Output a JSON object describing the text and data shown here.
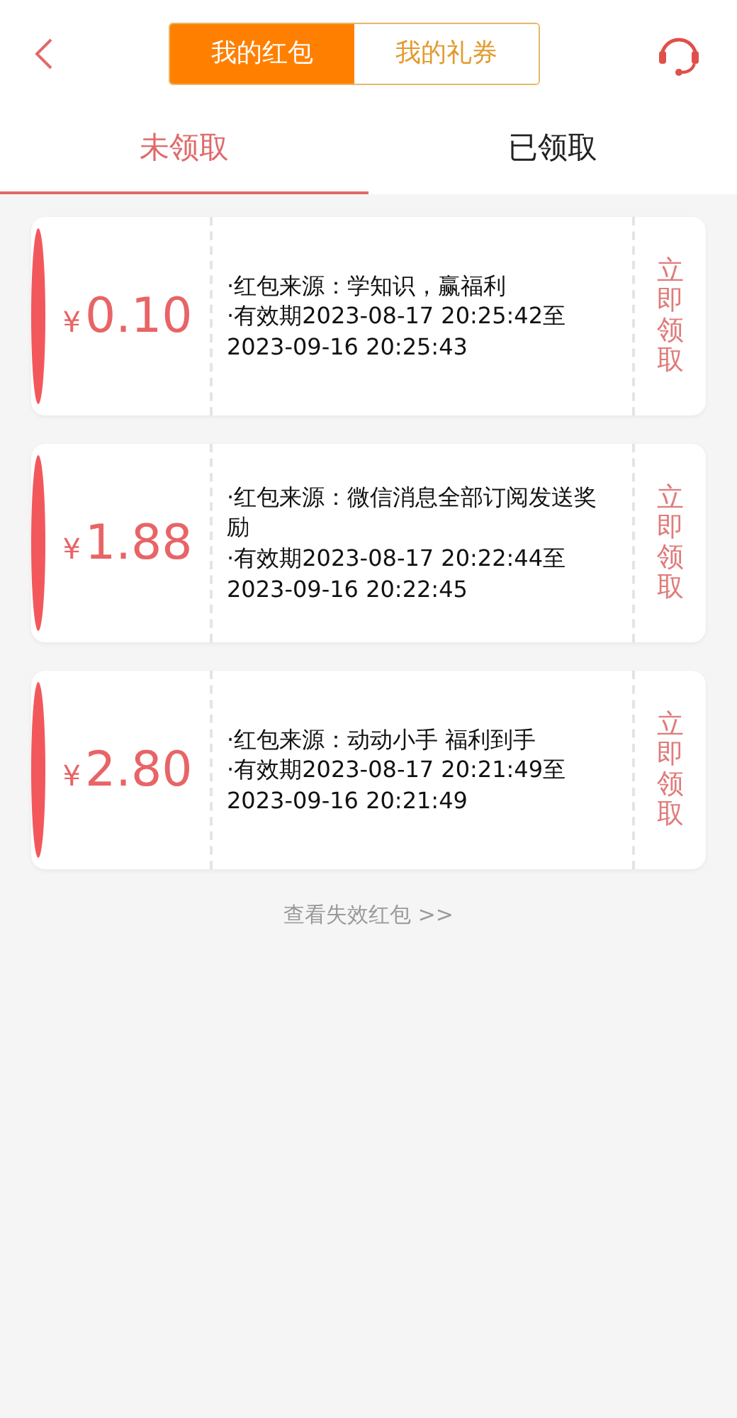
{
  "segments": [
    {
      "label": "我的红包",
      "selected": true
    },
    {
      "label": "我的礼券",
      "selected": false
    }
  ],
  "tabs": [
    {
      "label": "未领取",
      "selected": true
    },
    {
      "label": "已领取",
      "selected": false
    }
  ],
  "coupons": [
    {
      "currency": "¥",
      "amount": "0.10",
      "source": "·红包来源：学知识，赢福利",
      "valid_from": "·有效期2023-08-17 20:25:42至",
      "valid_to": "2023-09-16 20:25:43",
      "action": "立即领取"
    },
    {
      "currency": "¥",
      "amount": "1.88",
      "source": "·红包来源：微信消息全部订阅发送奖励",
      "valid_from": "·有效期2023-08-17 20:22:44至",
      "valid_to": "2023-09-16 20:22:45",
      "action": "立即领取"
    },
    {
      "currency": "¥",
      "amount": "2.80",
      "source": "·红包来源：动动小手 福利到手",
      "valid_from": "·有效期2023-08-17 20:21:49至",
      "valid_to": "2023-09-16 20:21:49",
      "action": "立即领取"
    }
  ],
  "footer_link": "查看失效红包 >>"
}
